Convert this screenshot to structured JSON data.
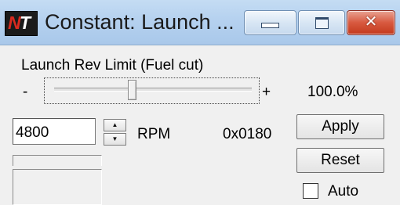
{
  "window": {
    "icon_text_n": "N",
    "icon_text_t": "T",
    "title": "Constant: Launch ...",
    "buttons": {
      "minimize_icon": "minimize-icon",
      "maximize_icon": "maximize-icon",
      "close_glyph": "✕"
    }
  },
  "panel": {
    "label": "Launch Rev Limit (Fuel cut)",
    "slider": {
      "minus": "-",
      "plus": "+",
      "percent": "100.0%",
      "level": 0.39
    },
    "value": "4800",
    "spin_up": "▲",
    "spin_down": "▼",
    "unit": "RPM",
    "hex": "0x0180",
    "apply_label": "Apply",
    "reset_label": "Reset",
    "auto_label": "Auto",
    "auto_checked": false
  },
  "colors": {
    "titlebar": "#b5d1ef",
    "close_button": "#d8593f",
    "background": "#f0f0f0"
  }
}
